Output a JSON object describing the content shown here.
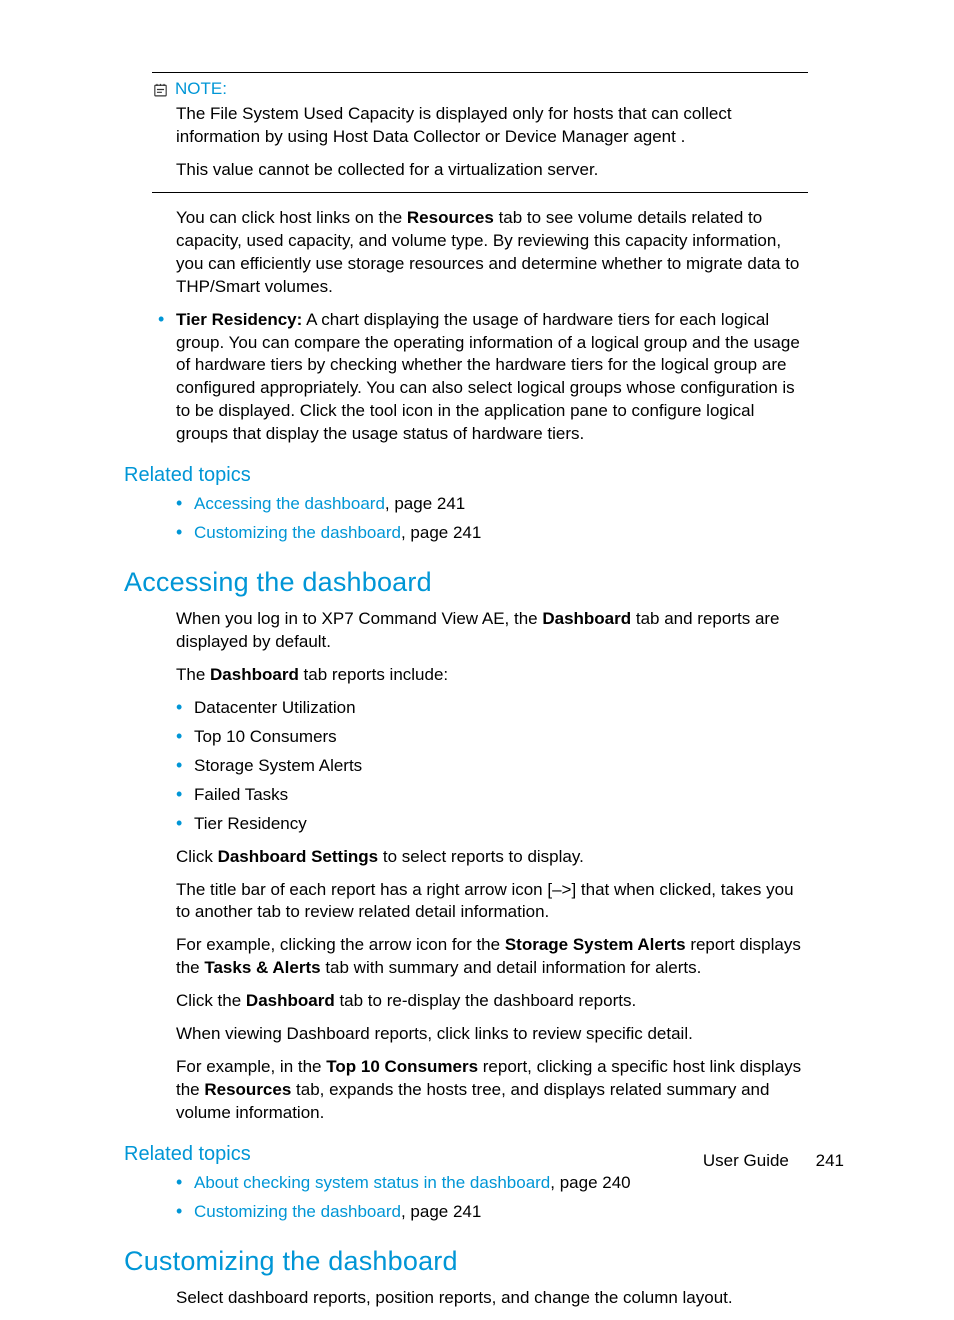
{
  "note": {
    "label": "NOTE:",
    "p1": "The File System Used Capacity is displayed only for hosts that can collect information by using Host Data Collector or Device Manager agent .",
    "p2": "This value cannot be collected for a virtualization server."
  },
  "para_resources_pre": "You can click host links on the ",
  "para_resources_bold": "Resources",
  "para_resources_post": " tab to see volume details related to capacity, used capacity, and volume type. By reviewing this capacity information, you can efficiently use storage resources and determine whether to migrate data to THP/Smart volumes.",
  "tier_label": "Tier Residency:",
  "tier_body": " A chart displaying the usage of hardware tiers for each logical group. You can compare the operating information of a logical group and the usage of hardware tiers by checking whether the hardware tiers for the logical group are configured appropriately. You can also select logical groups whose configuration is to be displayed. Click the tool icon in the application pane to configure logical groups that display the usage status of hardware tiers.",
  "related1": {
    "heading": "Related topics",
    "items": [
      {
        "link": "Accessing the dashboard",
        "suffix": ", page 241"
      },
      {
        "link": "Customizing the dashboard",
        "suffix": ", page 241"
      }
    ]
  },
  "accessing": {
    "heading": "Accessing the dashboard",
    "p1_pre": "When you log in to XP7 Command View AE, the ",
    "p1_bold": "Dashboard",
    "p1_post": " tab and reports are displayed by default.",
    "p2_pre": "The ",
    "p2_bold": "Dashboard",
    "p2_post": " tab reports include:",
    "reports": [
      "Datacenter Utilization",
      "Top 10 Consumers",
      "Storage System Alerts",
      "Failed Tasks",
      "Tier Residency"
    ],
    "p3_pre": "Click ",
    "p3_bold": "Dashboard Settings",
    "p3_post": " to select reports to display.",
    "p4": "The title bar of each report has a right arrow icon [–>] that when clicked, takes you to another tab to review related detail information.",
    "p5_pre": "For example, clicking the arrow icon for the ",
    "p5_bold1": "Storage System Alerts",
    "p5_mid": " report displays the ",
    "p5_bold2": "Tasks & Alerts",
    "p5_post": " tab with summary and detail information for alerts.",
    "p6_pre": "Click the ",
    "p6_bold": "Dashboard",
    "p6_post": " tab to re-display the dashboard reports.",
    "p7": "When viewing Dashboard reports, click links to review specific detail.",
    "p8_pre": "For example, in the ",
    "p8_bold1": "Top 10 Consumers",
    "p8_mid": " report, clicking a specific host link displays the ",
    "p8_bold2": "Resources",
    "p8_post": " tab, expands the hosts tree, and displays related summary and volume information."
  },
  "related2": {
    "heading": "Related topics",
    "items": [
      {
        "link": "About checking system status in the dashboard",
        "suffix": ", page 240"
      },
      {
        "link": "Customizing the dashboard",
        "suffix": ", page 241"
      }
    ]
  },
  "customizing": {
    "heading": "Customizing the dashboard",
    "p1": "Select dashboard reports, position reports, and change the column layout."
  },
  "footer": {
    "label": "User Guide",
    "page": "241"
  }
}
